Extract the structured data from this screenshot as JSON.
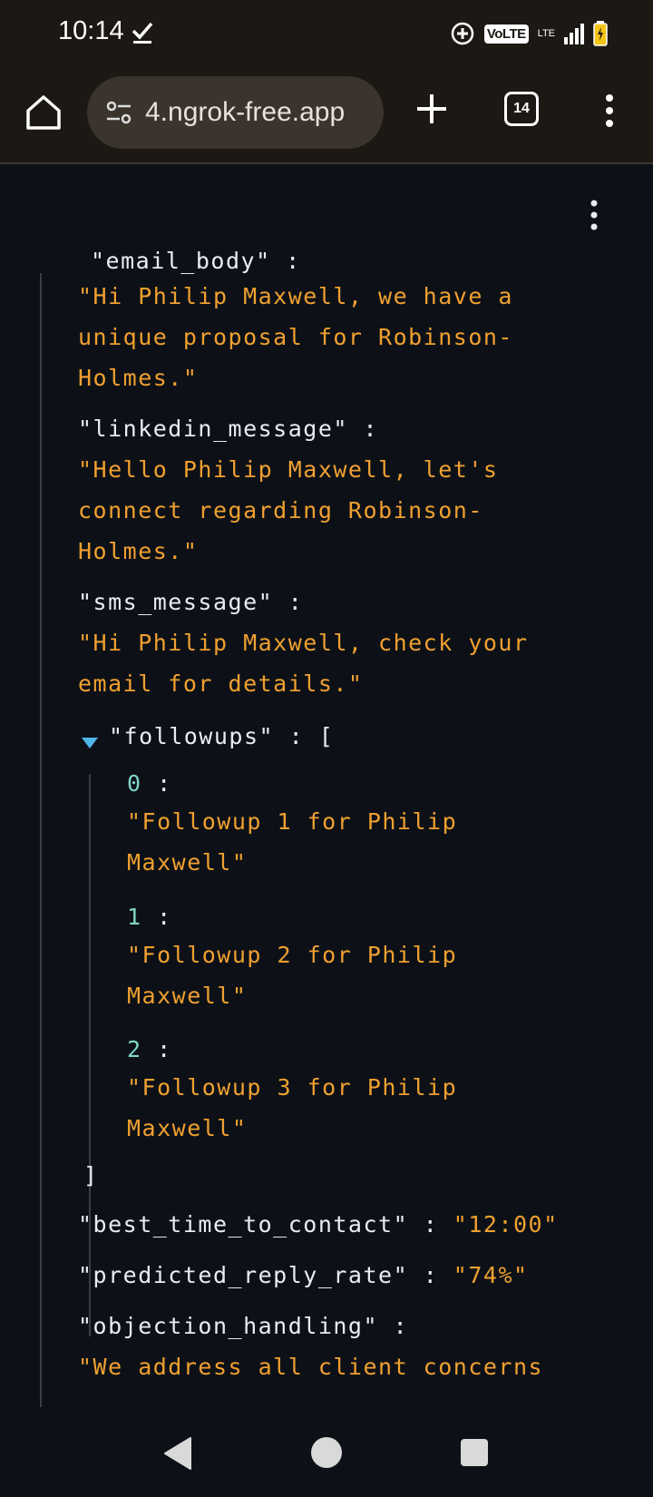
{
  "status_bar": {
    "time": "10:14",
    "volte": "VoLTE",
    "lte": "LTE"
  },
  "browser": {
    "url": "4.ngrok-free.app",
    "tab_count": "14"
  },
  "json": {
    "clipped_key": "\"email_body\" :",
    "email_body_1": "\"Hi Philip Maxwell, we have a",
    "email_body_2": "unique proposal for Robinson-",
    "email_body_3": "Holmes.\"",
    "linkedin_key": "\"linkedin_message\"",
    "linkedin_1": "\"Hello Philip Maxwell, let's",
    "linkedin_2": "connect regarding Robinson-",
    "linkedin_3": "Holmes.\"",
    "sms_key": "\"sms_message\"",
    "sms_1": "\"Hi Philip Maxwell, check your",
    "sms_2": "email for details.\"",
    "followups_key": "\"followups\"",
    "followups": [
      {
        "index": "0",
        "line1": "\"Followup 1 for Philip",
        "line2": "Maxwell\""
      },
      {
        "index": "1",
        "line1": "\"Followup 2 for Philip",
        "line2": "Maxwell\""
      },
      {
        "index": "2",
        "line1": "\"Followup 3 for Philip",
        "line2": "Maxwell\""
      }
    ],
    "best_time_key": "\"best_time_to_contact\"",
    "best_time_value": "\"12:00\"",
    "reply_rate_key": "\"predicted_reply_rate\"",
    "reply_rate_value": "\"74%\"",
    "objection_key": "\"objection_handling\"",
    "objection_1": "\"We address all client concerns"
  },
  "colors": {
    "key": "#e6edf3",
    "string": "#f0a030",
    "index": "#7fd4c8",
    "background": "#0d1117",
    "toolbar": "#1c1813"
  }
}
